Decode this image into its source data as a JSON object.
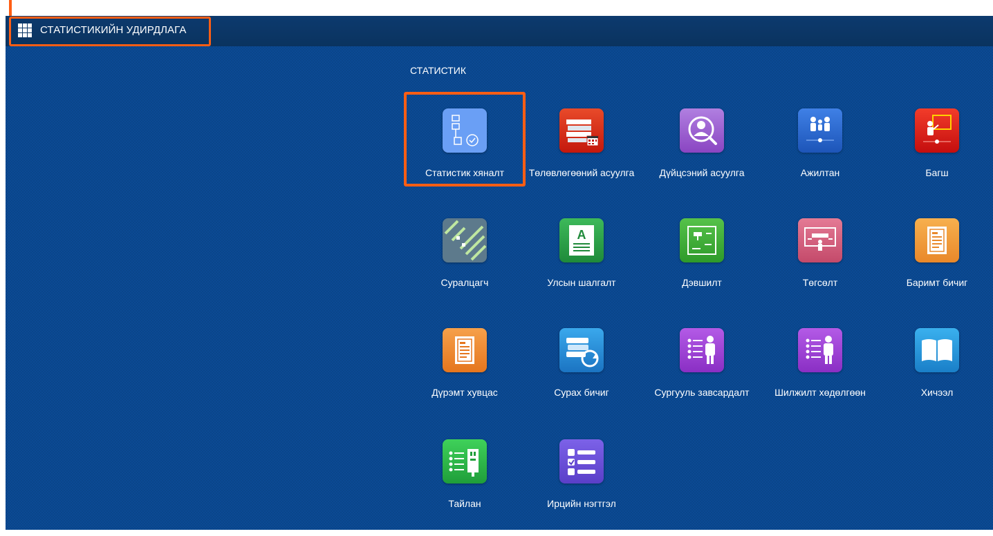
{
  "header": {
    "app_title": "СТАТИСТИКИЙН УДИРДЛАГА"
  },
  "section": {
    "title": "СТАТИСТИК"
  },
  "tiles": [
    {
      "label": "Статистик хяналт",
      "icon": "flowchart-check-icon",
      "color": "#6a9ff5"
    },
    {
      "label": "Төлөвлөгөөний асуулга",
      "icon": "books-calendar-icon",
      "color": "#e0301e"
    },
    {
      "label": "Дүйцсэний асуулга",
      "icon": "user-search-icon",
      "color": "#9b59c9"
    },
    {
      "label": "Ажилтан",
      "icon": "staff-group-icon",
      "color": "#2f6fd6"
    },
    {
      "label": "Багш",
      "icon": "teacher-board-icon",
      "color": "#e52020"
    },
    {
      "label": "Суралцагч",
      "icon": "student-list-icon",
      "color": "#607d8b"
    },
    {
      "label": "Улсын шалгалт",
      "icon": "exam-sheet-icon",
      "color": "#2e9e48"
    },
    {
      "label": "Дэвшилт",
      "icon": "promotion-board-icon",
      "color": "#3fae3a"
    },
    {
      "label": "Төгсөлт",
      "icon": "graduation-icon",
      "color": "#d45a7a"
    },
    {
      "label": "Баримт бичиг",
      "icon": "document-icon",
      "color": "#f39c3c"
    },
    {
      "label": "Дүрэмт хувцас",
      "icon": "uniform-document-icon",
      "color": "#f08a2a"
    },
    {
      "label": "Сурах бичиг",
      "icon": "textbook-sync-icon",
      "color": "#2a8fd8"
    },
    {
      "label": "Сургууль завсардалт",
      "icon": "dropout-list-icon",
      "color": "#9b3fd1"
    },
    {
      "label": "Шилжилт хөдөлгөөн",
      "icon": "transfer-list-icon",
      "color": "#9b3fd1"
    },
    {
      "label": "Хичээл",
      "icon": "open-book-icon",
      "color": "#2a9ad8"
    },
    {
      "label": "Тайлан",
      "icon": "report-list-icon",
      "color": "#2fb84a"
    },
    {
      "label": "Ирцийн нэгтгэл",
      "icon": "attendance-list-icon",
      "color": "#6a4fd6"
    }
  ]
}
